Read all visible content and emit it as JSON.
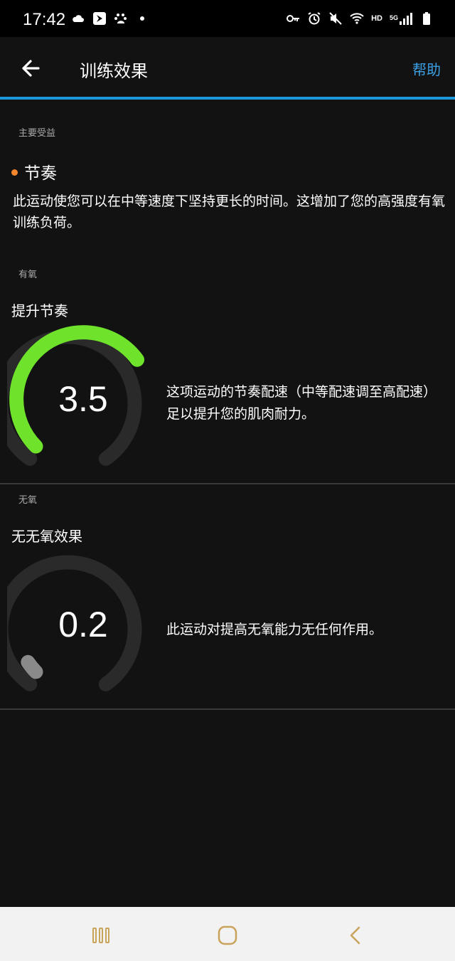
{
  "status_bar": {
    "time": "17:42",
    "hd": "HD",
    "network": "5G",
    "left_icons": [
      "cloud-icon",
      "bird-app-icon",
      "baidu-icon",
      "dot-icon"
    ],
    "right_icons": [
      "key-icon",
      "alarm-icon",
      "mute-icon",
      "wifi-icon",
      "signal-icon",
      "battery-icon"
    ]
  },
  "appbar": {
    "title": "训练效果",
    "help_label": "帮助"
  },
  "primary_benefit": {
    "section_label": "主要受益",
    "title": "节奏",
    "description": "此运动使您可以在中等速度下坚持更长的时间。这增加了您的高强度有氧训练负荷。",
    "dot_color": "#f5862b"
  },
  "aerobic": {
    "section_label": "有氧",
    "title": "提升节奏",
    "value": "3.5",
    "value_max": 5,
    "arc_color": "#6fe32b",
    "description": "这项运动的节奏配速（中等配速调至高配速）足以提升您的肌肉耐力。"
  },
  "anaerobic": {
    "section_label": "无氧",
    "title": "无无氧效果",
    "value": "0.2",
    "value_max": 5,
    "arc_color": "#8a8a8a",
    "description": "此运动对提高无氧能力无任何作用。"
  },
  "colors": {
    "background": "#121212",
    "accent": "#1c97dc",
    "help_text": "#3b9fe3",
    "track": "#2a2a2a"
  }
}
